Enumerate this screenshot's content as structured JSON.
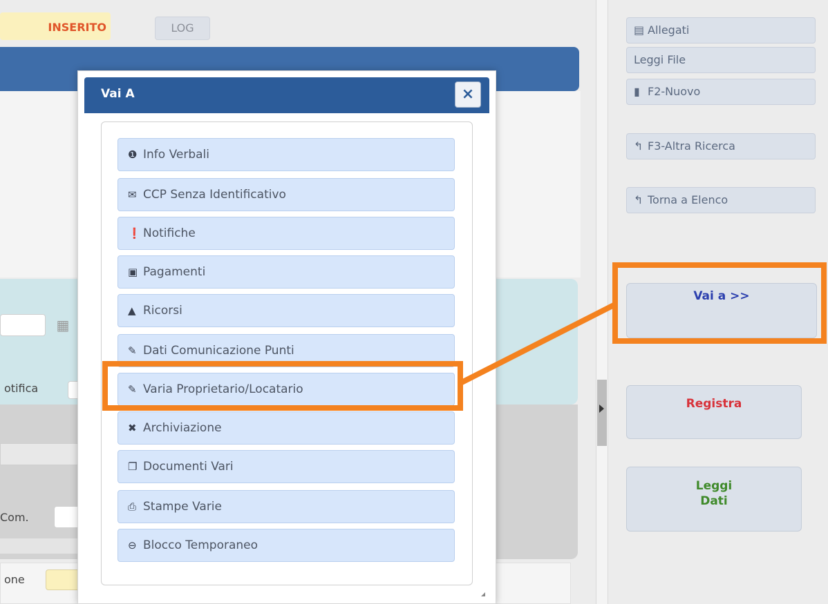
{
  "background_form": {
    "status_badge": "INSERITO",
    "log_tab": "LOG",
    "label_notifica": "otifica",
    "label_com": "Com.",
    "label_one": "one"
  },
  "sidebar": {
    "allegati": "Allegati",
    "leggi_file": "Leggi File",
    "nuovo": "F2-Nuovo",
    "altra_ricerca": "F3-Altra Ricerca",
    "torna_elenco": "Torna a Elenco",
    "vai_a": "Vai a >>",
    "registra": "Registra",
    "leggi_dati_line1": "Leggi",
    "leggi_dati_line2": "Dati"
  },
  "modal": {
    "title": "Vai A",
    "close_label": "×",
    "items": [
      {
        "label": "Info Verbali",
        "icon": "info-circle-icon",
        "glyph": "❶"
      },
      {
        "label": "CCP Senza Identificativo",
        "icon": "envelope-icon",
        "glyph": "✉"
      },
      {
        "label": "Notifiche",
        "icon": "exclamation-circle-icon",
        "glyph": "❗"
      },
      {
        "label": "Pagamenti",
        "icon": "inbox-icon",
        "glyph": "▣"
      },
      {
        "label": "Ricorsi",
        "icon": "warning-icon",
        "glyph": "▲"
      },
      {
        "label": "Dati Comunicazione Punti",
        "icon": "pencil-icon",
        "glyph": "✎"
      },
      {
        "label": "Varia Proprietario/Locatario",
        "icon": "pencil-icon",
        "glyph": "✎"
      },
      {
        "label": "Archiviazione",
        "icon": "times-circle-icon",
        "glyph": "✖"
      },
      {
        "label": "Documenti Vari",
        "icon": "files-icon",
        "glyph": "❐"
      },
      {
        "label": "Stampe Varie",
        "icon": "print-icon",
        "glyph": "⎙"
      },
      {
        "label": "Blocco Temporaneo",
        "icon": "minus-circle-icon",
        "glyph": "⊖"
      }
    ]
  },
  "colors": {
    "highlight": "#f4821f",
    "modal_header": "#2c5c9a",
    "menu_item_bg": "#d7e6fb"
  }
}
